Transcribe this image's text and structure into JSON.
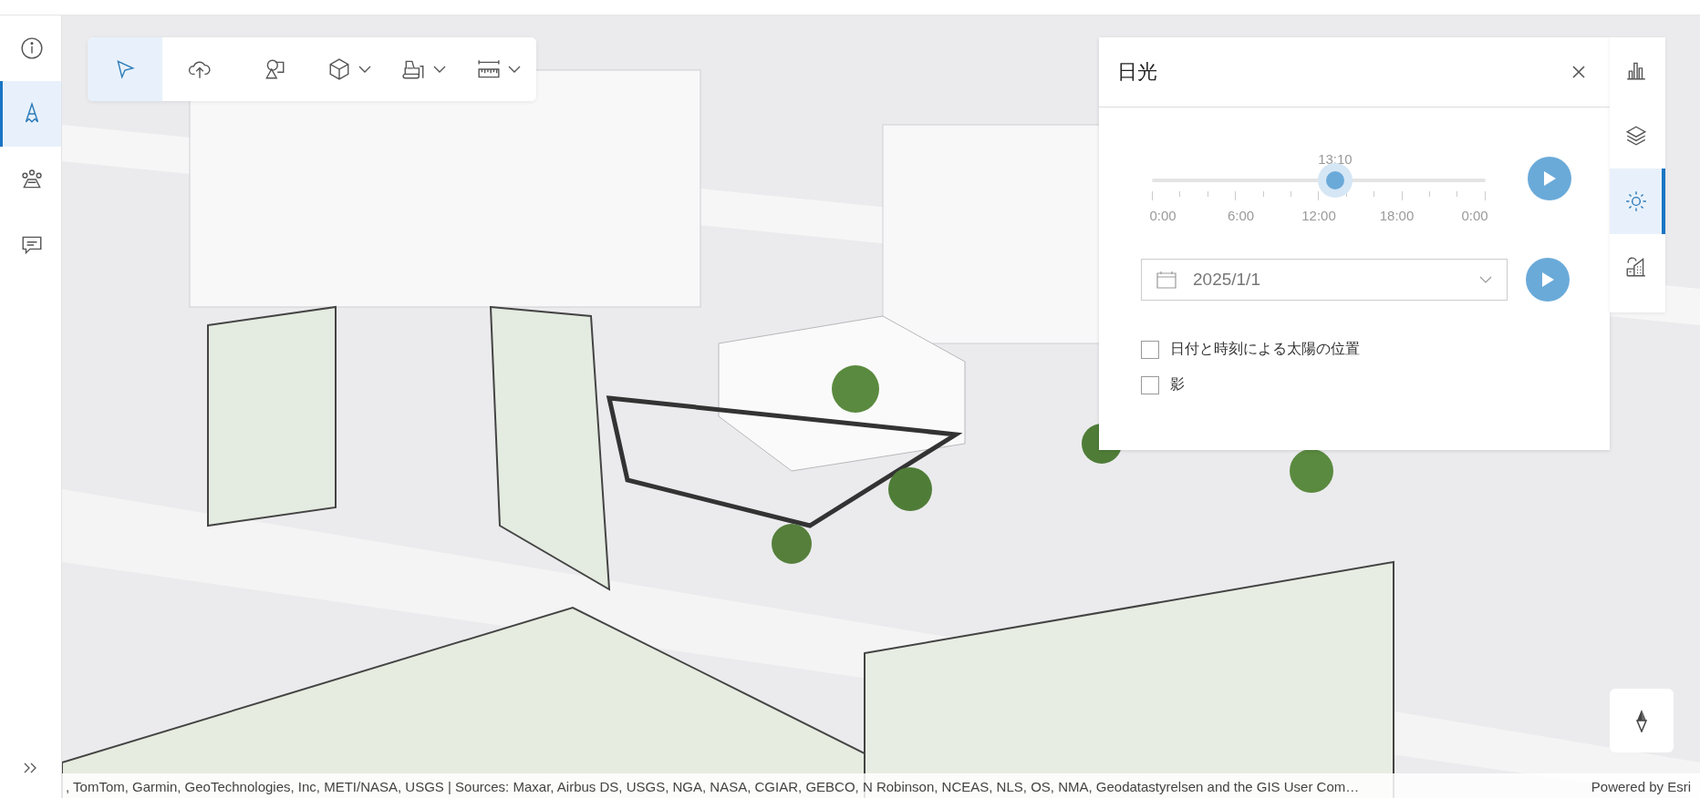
{
  "left_nav": {
    "items": [
      {
        "kind": "info",
        "selected": false
      },
      {
        "kind": "sketch",
        "selected": true
      },
      {
        "kind": "people",
        "selected": false
      },
      {
        "kind": "comment",
        "selected": false
      }
    ]
  },
  "toolbar": {
    "tools": [
      {
        "kind": "select",
        "selected": true,
        "has_menu": false
      },
      {
        "kind": "upload",
        "selected": false,
        "has_menu": false
      },
      {
        "kind": "shapes",
        "selected": false,
        "has_menu": false
      },
      {
        "kind": "cube",
        "selected": false,
        "has_menu": true
      },
      {
        "kind": "bulldozer",
        "selected": false,
        "has_menu": true
      },
      {
        "kind": "ruler",
        "selected": false,
        "has_menu": true
      }
    ]
  },
  "panel": {
    "title": "日光",
    "time": "13:10",
    "slider": {
      "level": 0.549,
      "tick_labels": [
        "0:00",
        "6:00",
        "12:00",
        "18:00",
        "0:00"
      ]
    },
    "date": "2025/1/1",
    "checkboxes": [
      {
        "label": "日付と時刻による太陽の位置",
        "checked": false
      },
      {
        "label": "影",
        "checked": false
      }
    ]
  },
  "right_nav": {
    "items": [
      {
        "kind": "chart",
        "selected": false
      },
      {
        "kind": "layers",
        "selected": false
      },
      {
        "kind": "sun",
        "selected": true
      },
      {
        "kind": "city",
        "selected": false
      }
    ]
  },
  "attribution": {
    "text": ", TomTom, Garmin, GeoTechnologies, Inc, METI/NASA, USGS | Sources: Maxar, Airbus DS, USGS, NGA, NASA, CGIAR, GEBCO, N Robinson, NCEAS, NLS, OS, NMA, Geodatastyrelsen and the GIS User Com…",
    "powered_by": "Powered by Esri"
  }
}
